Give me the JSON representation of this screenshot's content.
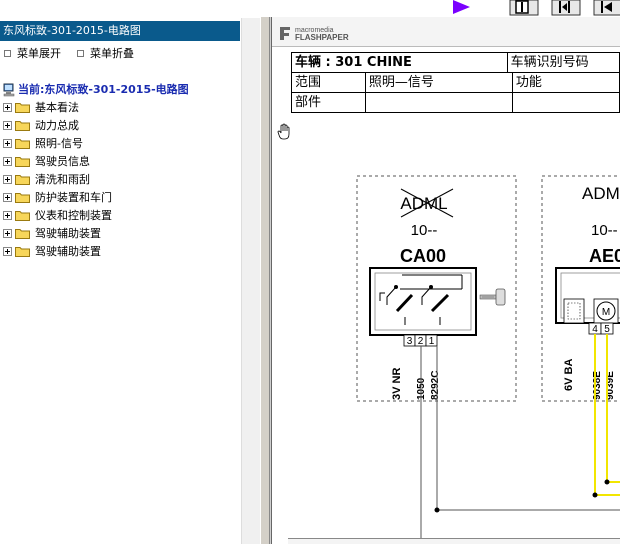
{
  "left_panel": {
    "title": "东风标致-301-2015-电路图",
    "expand_label": "菜单展开",
    "collapse_label": "菜单折叠",
    "current_prefix": "当前:",
    "current_value": "东风标致-301-2015-电路图",
    "tree_items": [
      {
        "label": "基本看法"
      },
      {
        "label": "动力总成"
      },
      {
        "label": "照明-信号"
      },
      {
        "label": "驾驶员信息"
      },
      {
        "label": "清洗和雨刮"
      },
      {
        "label": "防护装置和车门"
      },
      {
        "label": "仪表和控制装置"
      },
      {
        "label": "驾驶辅助装置"
      },
      {
        "label": "驾驶辅助装置"
      }
    ]
  },
  "viewer": {
    "logo_top": "macromedia",
    "logo_bottom": "FLASHPAPER",
    "header_table": {
      "vehicle_label": "车辆 : 301 CHINE",
      "vin_label": "车辆识别号码",
      "scope_label": "范围",
      "scope_value": "照明—信号",
      "function_label": "功能",
      "part_label": "部件"
    },
    "diagram": {
      "box1": {
        "crossed_label": "ADML",
        "code_prefix": "10--",
        "name": "CA00",
        "pins": [
          "3",
          "2",
          "1"
        ],
        "side_label": "3V NR",
        "wires": [
          "1050",
          "8292C"
        ]
      },
      "box2": {
        "label": "ADM",
        "code_prefix": "10--",
        "name": "AE0",
        "pins": [
          "4",
          "5"
        ],
        "side_label": "6V BA",
        "wires": [
          "9038E",
          "9039E"
        ]
      }
    }
  },
  "colors": {
    "title_bar": "#0a5a8c",
    "current_text": "#1a2cb0",
    "wire_yellow": "#f2e600",
    "toolbar_arrow": "#7a00ff"
  }
}
